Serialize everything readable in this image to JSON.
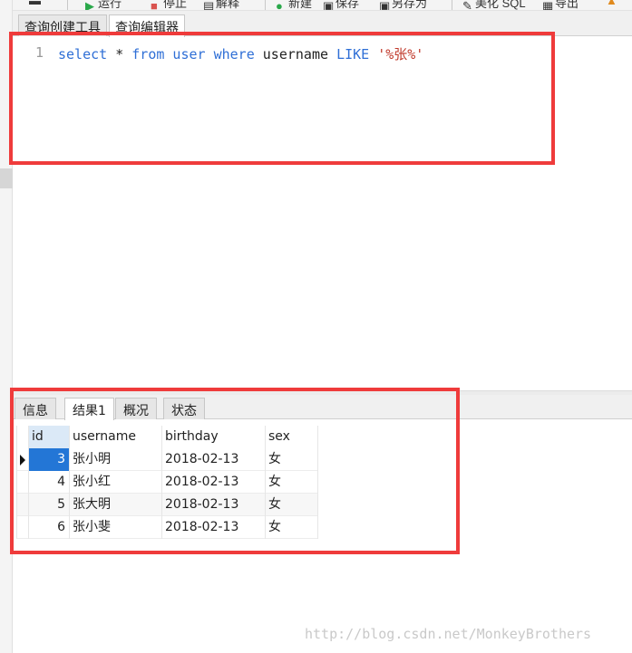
{
  "toolbar": {
    "items": [
      "运行",
      "停止",
      "解释",
      "新建",
      "保存",
      "另存为",
      "美化 SQL",
      "导出"
    ]
  },
  "query_tabs": [
    {
      "label": "查询创建工具"
    },
    {
      "label": "查询编辑器"
    }
  ],
  "editor": {
    "line_number": "1",
    "tokens": {
      "select": "select",
      "star": " * ",
      "from": "from",
      "user": " user ",
      "where": "where",
      "column": " username ",
      "like": "LIKE",
      "space": " ",
      "pattern": "'%张%'"
    }
  },
  "result_tabs": [
    {
      "label": "信息"
    },
    {
      "label": "结果1"
    },
    {
      "label": "概况"
    },
    {
      "label": "状态"
    }
  ],
  "results": {
    "columns": [
      "id",
      "username",
      "birthday",
      "sex"
    ],
    "rows": [
      {
        "id": "3",
        "username": "张小明",
        "birthday": "2018-02-13",
        "sex": "女"
      },
      {
        "id": "4",
        "username": "张小红",
        "birthday": "2018-02-13",
        "sex": "女"
      },
      {
        "id": "5",
        "username": "张大明",
        "birthday": "2018-02-13",
        "sex": "女"
      },
      {
        "id": "6",
        "username": "张小斐",
        "birthday": "2018-02-13",
        "sex": "女"
      }
    ]
  },
  "watermark": "http://blog.csdn.net/MonkeyBrothers",
  "colors": {
    "keyword": "#2f6fd6",
    "string": "#c0392b",
    "highlight_border": "#ef3b3b",
    "selected_cell": "#2376d6"
  }
}
